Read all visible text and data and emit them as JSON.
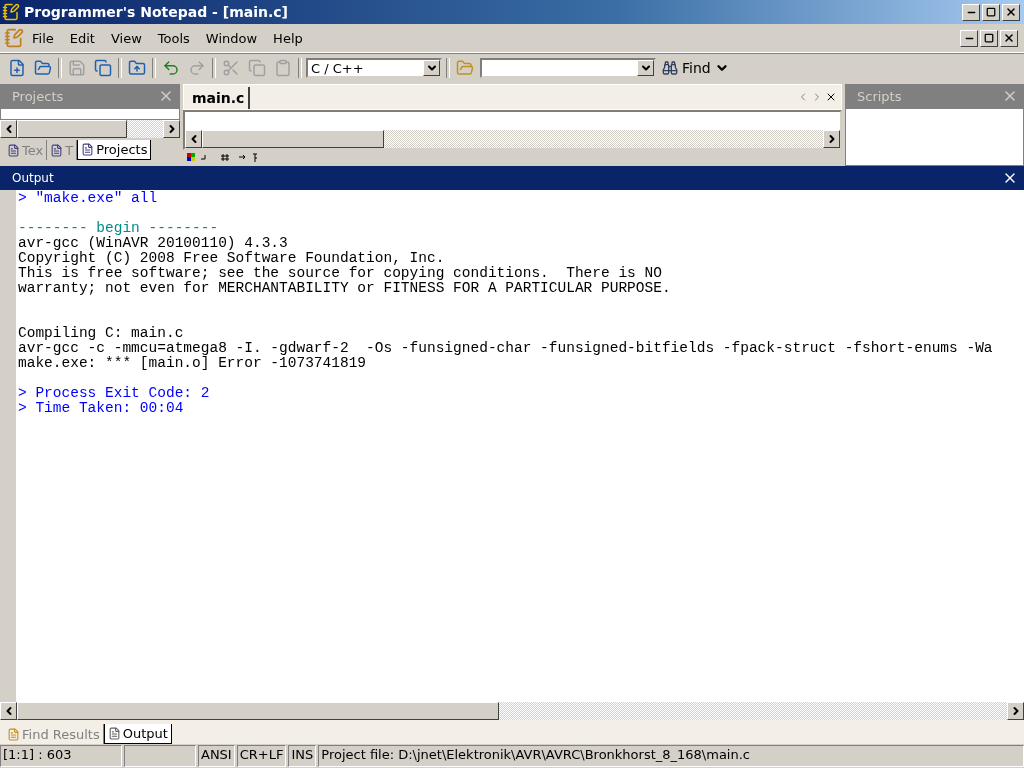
{
  "window": {
    "title": "Programmer's Notepad - [main.c]"
  },
  "menu": [
    "File",
    "Edit",
    "View",
    "Tools",
    "Window",
    "Help"
  ],
  "toolbar": {
    "buttons": [
      {
        "kind": "new",
        "disabled": false
      },
      {
        "kind": "open",
        "disabled": false
      },
      {
        "kind": "sep"
      },
      {
        "kind": "save",
        "disabled": true
      },
      {
        "kind": "saveall",
        "disabled": false
      },
      {
        "kind": "sep"
      },
      {
        "kind": "project",
        "disabled": false
      },
      {
        "kind": "sep"
      },
      {
        "kind": "undo",
        "disabled": false
      },
      {
        "kind": "redo",
        "disabled": true
      },
      {
        "kind": "sep"
      },
      {
        "kind": "cut",
        "disabled": true
      },
      {
        "kind": "copy",
        "disabled": true
      },
      {
        "kind": "paste",
        "disabled": true
      }
    ],
    "language": "C / C++",
    "find": "Find"
  },
  "projects_panel": {
    "title": "Projects",
    "tabs": [
      {
        "label": "Tex",
        "selected": false
      },
      {
        "label": "T",
        "selected": false
      },
      {
        "label": "Projects",
        "selected": true
      }
    ]
  },
  "editor": {
    "tabs": [
      {
        "label": "main.c",
        "selected": true
      }
    ]
  },
  "scripts_panel": {
    "title": "Scripts"
  },
  "output": {
    "title": "Output",
    "lines": [
      {
        "kind": "command",
        "text": "> \"make.exe\" all"
      },
      {
        "kind": "blank"
      },
      {
        "kind": "banner",
        "text": "-------- begin --------"
      },
      {
        "kind": "plain",
        "text": "avr-gcc (WinAVR 20100110) 4.3.3"
      },
      {
        "kind": "plain",
        "text": "Copyright (C) 2008 Free Software Foundation, Inc."
      },
      {
        "kind": "plain",
        "text": "This is free software; see the source for copying conditions.  There is NO"
      },
      {
        "kind": "plain",
        "text": "warranty; not even for MERCHANTABILITY or FITNESS FOR A PARTICULAR PURPOSE."
      },
      {
        "kind": "blank"
      },
      {
        "kind": "blank"
      },
      {
        "kind": "plain",
        "text": "Compiling C: main.c"
      },
      {
        "kind": "plain",
        "text": "avr-gcc -c -mmcu=atmega8 -I. -gdwarf-2  -Os -funsigned-char -funsigned-bitfields -fpack-struct -fshort-enums -Wa"
      },
      {
        "kind": "plain",
        "text": "make.exe: *** [main.o] Error -1073741819"
      },
      {
        "kind": "blank"
      },
      {
        "kind": "command",
        "text": "> Process Exit Code: 2"
      },
      {
        "kind": "command",
        "text": "> Time Taken: 00:04"
      }
    ]
  },
  "bottom_tabs": [
    {
      "label": "Find Results",
      "selected": false
    },
    {
      "label": "Output",
      "selected": true
    }
  ],
  "status_bar": [
    {
      "kind": "text",
      "text": "[1:1] : 603"
    },
    {
      "kind": "blank"
    },
    {
      "kind": "text",
      "text": "ANSI"
    },
    {
      "kind": "text",
      "text": "CR+LF"
    },
    {
      "kind": "text",
      "text": "INS"
    },
    {
      "kind": "wide",
      "text": "Project file: D:\\jnet\\Elektronik\\AVR\\AVRC\\Bronkhorst_8_168\\main.c"
    }
  ]
}
